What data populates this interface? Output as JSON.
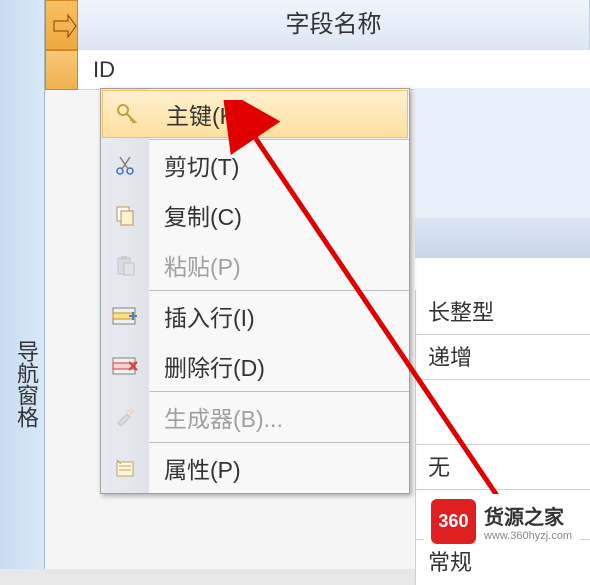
{
  "sidebar": {
    "title": "导航窗格"
  },
  "grid": {
    "column_header": "字段名称",
    "field_name": "ID"
  },
  "context_menu": {
    "items": [
      {
        "key": "primary_key",
        "label": "主键(K)",
        "icon": "key-icon",
        "highlighted": true
      },
      {
        "key": "cut",
        "label": "剪切(T)",
        "icon": "scissors-icon"
      },
      {
        "key": "copy",
        "label": "复制(C)",
        "icon": "copy-icon"
      },
      {
        "key": "paste",
        "label": "粘贴(P)",
        "icon": "paste-icon",
        "disabled": true
      },
      {
        "key": "insert_row",
        "label": "插入行(I)",
        "icon": "insert-row-icon"
      },
      {
        "key": "delete_row",
        "label": "删除行(D)",
        "icon": "delete-row-icon"
      },
      {
        "key": "builder",
        "label": "生成器(B)...",
        "icon": "builder-icon",
        "disabled": true
      },
      {
        "key": "properties",
        "label": "属性(P)",
        "icon": "properties-icon"
      }
    ]
  },
  "right_panel": {
    "rows": [
      "长整型",
      "递增",
      "",
      "无",
      "",
      "常规"
    ]
  },
  "watermark": {
    "logo_text": "360",
    "title": "货源之家",
    "url": "www.360hyzj.com"
  }
}
